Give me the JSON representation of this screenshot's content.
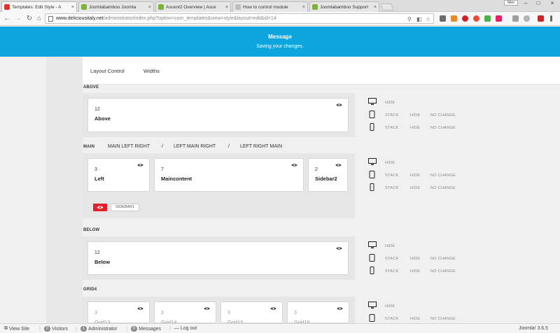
{
  "browser": {
    "tabs": [
      {
        "title": "Templates: Edit Style - A",
        "fav": "#e0312b",
        "active": true
      },
      {
        "title": "Joomlabamboo Joomla",
        "fav": "#7bb238",
        "active": false
      },
      {
        "title": "Ascent2 Overview | Asce",
        "fav": "#7bb238",
        "active": false
      },
      {
        "title": "How to control module",
        "fav": "#bdbdbd",
        "active": false
      },
      {
        "title": "Joomlabamboo Support",
        "fav": "#7bb238",
        "active": false
      }
    ],
    "tab_close": "×",
    "url_host": "www.deliciousitaly.net",
    "url_path": "/administrator/index.php?option=com_templates&view=style&layout=edit&id=14",
    "profile": "Men"
  },
  "message": {
    "heading": "Message",
    "text": "Saving your changes."
  },
  "tabs": {
    "layout_control": "Layout Control",
    "widths": "Widths"
  },
  "sections": {
    "above": {
      "label": "ABOVE",
      "cards": [
        {
          "num": "12",
          "name": "Above"
        }
      ],
      "options": [
        {
          "device": "desktop",
          "items": [
            "HIDE"
          ]
        },
        {
          "device": "tablet",
          "items": [
            "STACK",
            "HIDE",
            "NO CHANGE"
          ]
        },
        {
          "device": "phone",
          "items": [
            "STACK",
            "HIDE",
            "NO CHANGE"
          ]
        }
      ]
    },
    "main": {
      "label": "MAIN",
      "layout_options": [
        "MAIN LEFT RIGHT",
        "/",
        "LEFT MAIN RIGHT",
        "/",
        "LEFT RIGHT MAIN"
      ],
      "cards": [
        {
          "num": "3",
          "name": "Left"
        },
        {
          "num": "7",
          "name": "Maincontent"
        },
        {
          "num": "2",
          "name": "Sidebar2"
        }
      ],
      "hidden_chip": "SIDEBAR1",
      "options": [
        {
          "device": "desktop",
          "items": [
            "HIDE"
          ]
        },
        {
          "device": "tablet",
          "items": [
            "STACK",
            "HIDE",
            "NO CHANGE"
          ]
        },
        {
          "device": "phone",
          "items": [
            "STACK",
            "HIDE",
            "NO CHANGE"
          ]
        }
      ]
    },
    "below": {
      "label": "BELOW",
      "cards": [
        {
          "num": "12",
          "name": "Below"
        }
      ],
      "options": [
        {
          "device": "desktop",
          "items": [
            "HIDE"
          ]
        },
        {
          "device": "tablet",
          "items": [
            "STACK",
            "HIDE",
            "NO CHANGE"
          ]
        },
        {
          "device": "phone",
          "items": [
            "STACK",
            "HIDE",
            "NO CHANGE"
          ]
        }
      ]
    },
    "grid4": {
      "label": "GRID4",
      "cards": [
        {
          "num": "3",
          "name": "Grid13"
        },
        {
          "num": "3",
          "name": "Grid14"
        },
        {
          "num": "3",
          "name": "Grid15"
        },
        {
          "num": "3",
          "name": "Grid16"
        }
      ],
      "options": [
        {
          "device": "desktop",
          "items": [
            "HIDE"
          ]
        },
        {
          "device": "tablet",
          "items": [
            "STACK",
            "HIDE",
            "NO CHANGE"
          ]
        }
      ]
    }
  },
  "statusbar": {
    "view_site": "View Site",
    "visitors_count": "0",
    "visitors": "Visitors",
    "admin_count": "1",
    "admin": "Administrator",
    "messages_count": "0",
    "messages": "Messages",
    "logout": "Log out",
    "version": "Joomla! 3.6.5"
  },
  "colors": {
    "message_bg": "#0ea5de",
    "danger": "#e2202a"
  }
}
